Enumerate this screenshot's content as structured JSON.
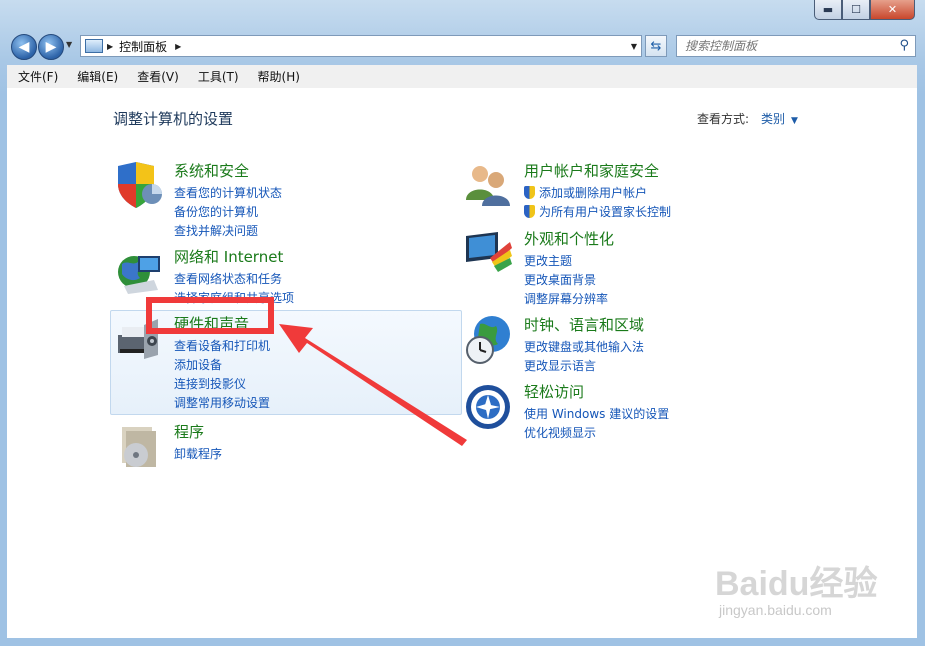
{
  "window": {
    "controls": {
      "minimize": "▬",
      "maximize": "☐",
      "close": "✕"
    }
  },
  "address": {
    "crumb": "控制面板"
  },
  "search": {
    "placeholder": "搜索控制面板"
  },
  "menu": [
    "文件(F)",
    "编辑(E)",
    "查看(V)",
    "工具(T)",
    "帮助(H)"
  ],
  "page": {
    "title": "调整计算机的设置",
    "view_label": "查看方式:",
    "view_value": "类别"
  },
  "categories": [
    {
      "title": "系统和安全",
      "icon": "shield-icon",
      "links": [
        "查看您的计算机状态",
        "备份您的计算机",
        "查找并解决问题"
      ]
    },
    {
      "title": "网络和 Internet",
      "icon": "network-icon",
      "links": [
        "查看网络状态和任务",
        "选择家庭组和共享选项"
      ]
    },
    {
      "title": "硬件和声音",
      "icon": "printer-icon",
      "links": [
        "查看设备和打印机",
        "添加设备",
        "连接到投影仪",
        "调整常用移动设置"
      ]
    },
    {
      "title": "程序",
      "icon": "programs-icon",
      "links": [
        "卸载程序"
      ]
    },
    {
      "title": "用户帐户和家庭安全",
      "icon": "users-icon",
      "links": [
        "添加或删除用户帐户",
        "为所有用户设置家长控制"
      ]
    },
    {
      "title": "外观和个性化",
      "icon": "monitor-icon",
      "links": [
        "更改主题",
        "更改桌面背景",
        "调整屏幕分辨率"
      ]
    },
    {
      "title": "时钟、语言和区域",
      "icon": "globe-clock-icon",
      "links": [
        "更改键盘或其他输入法",
        "更改显示语言"
      ]
    },
    {
      "title": "轻松访问",
      "icon": "accessibility-icon",
      "links": [
        "使用 Windows 建议的设置",
        "优化视频显示"
      ]
    }
  ],
  "colors": {
    "category_title": "#1a7a1a",
    "link": "#1556b8",
    "annotation": "#f03a3a"
  },
  "watermark": {
    "brand": "Baidu经验",
    "url": "jingyan.baidu.com"
  }
}
